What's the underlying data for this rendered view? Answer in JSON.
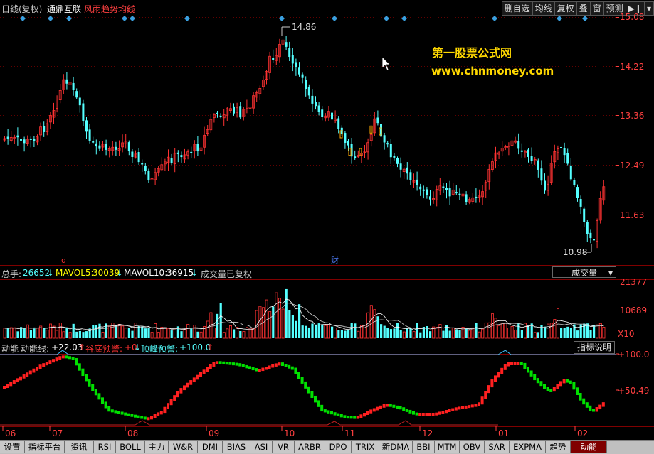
{
  "header": {
    "period": "日线(复权)",
    "stock_name": "通鼎互联",
    "indicator": "风雨趋势均线",
    "buttons": [
      "删自选",
      "均线",
      "复权",
      "叠",
      "窗",
      "预测"
    ]
  },
  "watermark": {
    "line1": "第一股票公式网",
    "line2": "www.chnmoney.com"
  },
  "price_axis": [
    "15.08",
    "14.22",
    "13.36",
    "12.49",
    "11.63"
  ],
  "price_annotations": {
    "high": "14.86",
    "low": "10.98"
  },
  "markers": {
    "q": "q",
    "cai": "财"
  },
  "volume": {
    "label": "总手:",
    "total": "26652",
    "ma5_label": "MAVOL5:",
    "ma5": "30039",
    "ma10_label": "MAVOL10:",
    "ma10": "36915",
    "note": "成交量已复权",
    "selector": "成交量",
    "axis": [
      "21377",
      "10689"
    ],
    "unit": "X10"
  },
  "indicator_panel": {
    "name": "动能",
    "line_label": "动能线:",
    "line_value": "+22.03",
    "bottom_label": "谷底预警:",
    "bottom_value": "+0",
    "top_label": "顶峰预警:",
    "top_value": "+100.0",
    "help_button": "指标说明",
    "axis": [
      "+100.0",
      "+50.49"
    ]
  },
  "x_axis": [
    "06",
    "07",
    "08",
    "09",
    "10",
    "11",
    "12",
    "01",
    "02"
  ],
  "tabs": [
    "设置",
    "指标平台",
    "资讯",
    "RSI",
    "BOLL",
    "主力",
    "W&R",
    "DMI",
    "BIAS",
    "ASI",
    "VR",
    "ARBR",
    "DPO",
    "TRIX",
    "新DMA",
    "BBI",
    "MTM",
    "OBV",
    "SAR",
    "EXPMA",
    "趋势",
    "动能"
  ],
  "active_tab": "动能",
  "colors": {
    "up": "#ff3232",
    "down": "#54ffff",
    "green": "#00e000",
    "red": "#ff2020",
    "orange": "#ffaa00",
    "grid": "#800000"
  }
}
